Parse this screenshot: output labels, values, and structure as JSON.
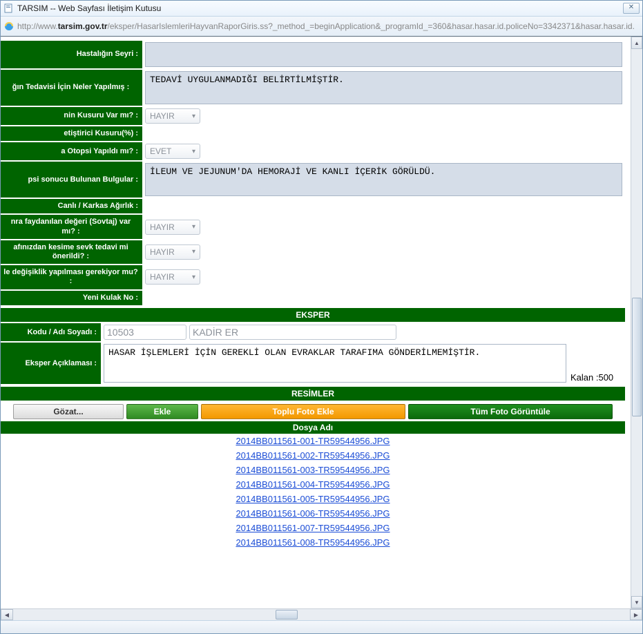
{
  "window": {
    "title": "TARSIM -- Web Sayfası İletişim Kutusu",
    "url_prefix": "http://www.",
    "url_host": "tarsim.gov.tr",
    "url_path": "/eksper/HasarIslemleriHayvanRaporGiris.ss?_method_=beginApplication&_programId_=360&hasar.hasar.id.policeNo=3342371&hasar.hasar.id."
  },
  "form": {
    "hastalik_seyri_label": "Hastalığın Seyri :",
    "hastalik_seyri_value": "",
    "tedavi_label": "ğın Tedavisi İçin Neler Yapılmış :",
    "tedavi_value": "TEDAVİ UYGULANMADIĞI BELİRTİLMİŞTİR.",
    "kusur_label": "nin Kusuru Var mı? :",
    "kusur_value": "HAYIR",
    "yetistirici_label": "etiştirici Kusuru(%) :",
    "otopsi_label": "a Otopsi Yapıldı mı? :",
    "otopsi_value": "EVET",
    "bulgular_label": "psi sonucu Bulunan Bulgular :",
    "bulgular_value": "İLEUM VE JEJUNUM'DA HEMORAJİ VE KANLI İÇERİK GÖRÜLDÜ.",
    "agirlik_label": "Canlı / Karkas Ağırlık :",
    "sovtaj_label": "nra faydanılan değeri (Sovtaj) var mı? :",
    "sovtaj_value": "HAYIR",
    "kesim_label": "afınızdan kesime sevk tedavi mi önerildi? :",
    "kesim_value": "HAYIR",
    "degisiklik_label": "le değişiklik yapılması gerekiyor mu? :",
    "degisiklik_value": "HAYIR",
    "yenikulak_label": "Yeni Kulak No :"
  },
  "eksper": {
    "header": "EKSPER",
    "kodu_label": "Kodu / Adı Soyadı :",
    "kodu_value": "10503",
    "ad_value": "KADİR ER",
    "aciklama_label": "Eksper Açıklaması :",
    "aciklama_value": "HASAR İŞLEMLERİ İÇİN GEREKLİ OLAN EVRAKLAR TARAFIMA GÖNDERİLMEMİŞTİR.",
    "kalan_label": "Kalan :500"
  },
  "resimler": {
    "header": "RESİMLER",
    "gozat": "Gözat...",
    "ekle": "Ekle",
    "toplu": "Toplu Foto Ekle",
    "tum": "Tüm Foto Görüntüle",
    "dosya_adi_header": "Dosya Adı",
    "files": [
      "2014BB011561-001-TR59544956.JPG",
      "2014BB011561-002-TR59544956.JPG",
      "2014BB011561-003-TR59544956.JPG",
      "2014BB011561-004-TR59544956.JPG",
      "2014BB011561-005-TR59544956.JPG",
      "2014BB011561-006-TR59544956.JPG",
      "2014BB011561-007-TR59544956.JPG",
      "2014BB011561-008-TR59544956.JPG"
    ]
  }
}
